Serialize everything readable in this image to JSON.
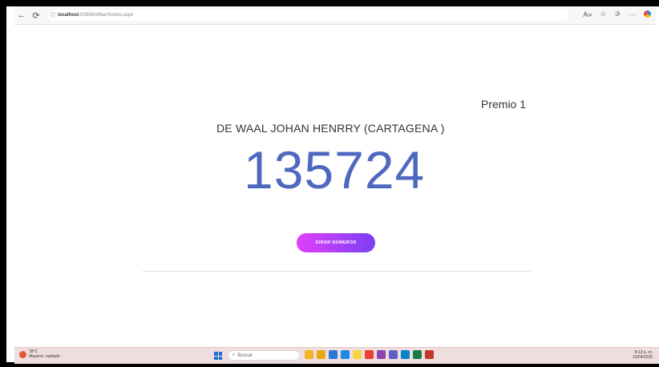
{
  "browser": {
    "url_host": "localhost",
    "url_path": ":50836/vMax/Sorteo.aspx"
  },
  "page": {
    "prize_label": "Premio 1",
    "winner_name": "DE WAAL JOHAN HENRRY (CARTAGENA )",
    "winning_number": "135724",
    "spin_button_label": "GIRAR NÚMEROS"
  },
  "taskbar": {
    "weather_temp": "18°C",
    "weather_desc": "Mayorm. nublado",
    "search_placeholder": "Buscar",
    "time": "8:13 a. m.",
    "date": "10/04/2025",
    "apps": [
      {
        "name": "explorer",
        "color": "#f0b429"
      },
      {
        "name": "folder",
        "color": "#e6a817"
      },
      {
        "name": "store",
        "color": "#2b7bd6"
      },
      {
        "name": "photos",
        "color": "#1e88e5"
      },
      {
        "name": "sticky",
        "color": "#f5d547"
      },
      {
        "name": "chrome",
        "color": "#ea4335"
      },
      {
        "name": "vs",
        "color": "#8e44ad"
      },
      {
        "name": "teams",
        "color": "#5b5fc7"
      },
      {
        "name": "edge",
        "color": "#0a84c9"
      },
      {
        "name": "excel",
        "color": "#1d7a45"
      },
      {
        "name": "app2",
        "color": "#c0392b"
      }
    ]
  }
}
